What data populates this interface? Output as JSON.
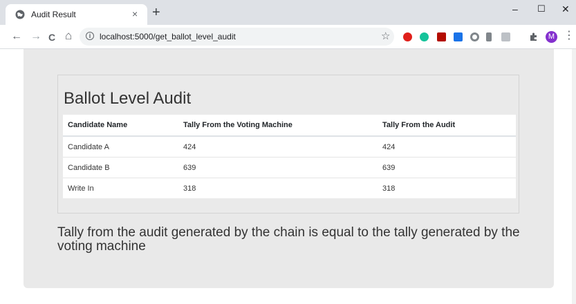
{
  "browser": {
    "tab_title": "Audit Result",
    "tab_close": "×",
    "new_tab": "+",
    "window_controls": {
      "minimize": "–",
      "maximize": "☐",
      "close": "✕"
    },
    "nav": {
      "back": "←",
      "forward": "→",
      "reload": "C",
      "home": "⌂"
    },
    "url": "localhost:5000/get_ballot_level_audit",
    "bookmark": "☆",
    "extensions": [
      {
        "name": "opera-icon",
        "color": "#e0201b"
      },
      {
        "name": "grammarly-icon",
        "color": "#15c39a"
      },
      {
        "name": "pdf-icon",
        "color": "#b30b00"
      },
      {
        "name": "blue-ext-icon",
        "color": "#1a73e8"
      },
      {
        "name": "circle-ext-icon",
        "color": "#80868b"
      },
      {
        "name": "download-icon",
        "color": "#80868b"
      },
      {
        "name": "gray-ext-icon",
        "color": "#bdc1c6"
      },
      {
        "name": "puzzle-icon",
        "color": "#5f6368"
      }
    ],
    "profile_initial": "M",
    "menu": "⋮"
  },
  "page": {
    "heading": "Ballot Level Audit",
    "table": {
      "headers": [
        "Candidate Name",
        "Tally From the Voting Machine",
        "Tally From the Audit"
      ],
      "rows": [
        [
          "Candidate A",
          "424",
          "424"
        ],
        [
          "Candidate B",
          "639",
          "639"
        ],
        [
          "Write In",
          "318",
          "318"
        ]
      ]
    },
    "summary": "Tally from the audit generated by the chain is equal to the tally generated by the voting machine"
  }
}
